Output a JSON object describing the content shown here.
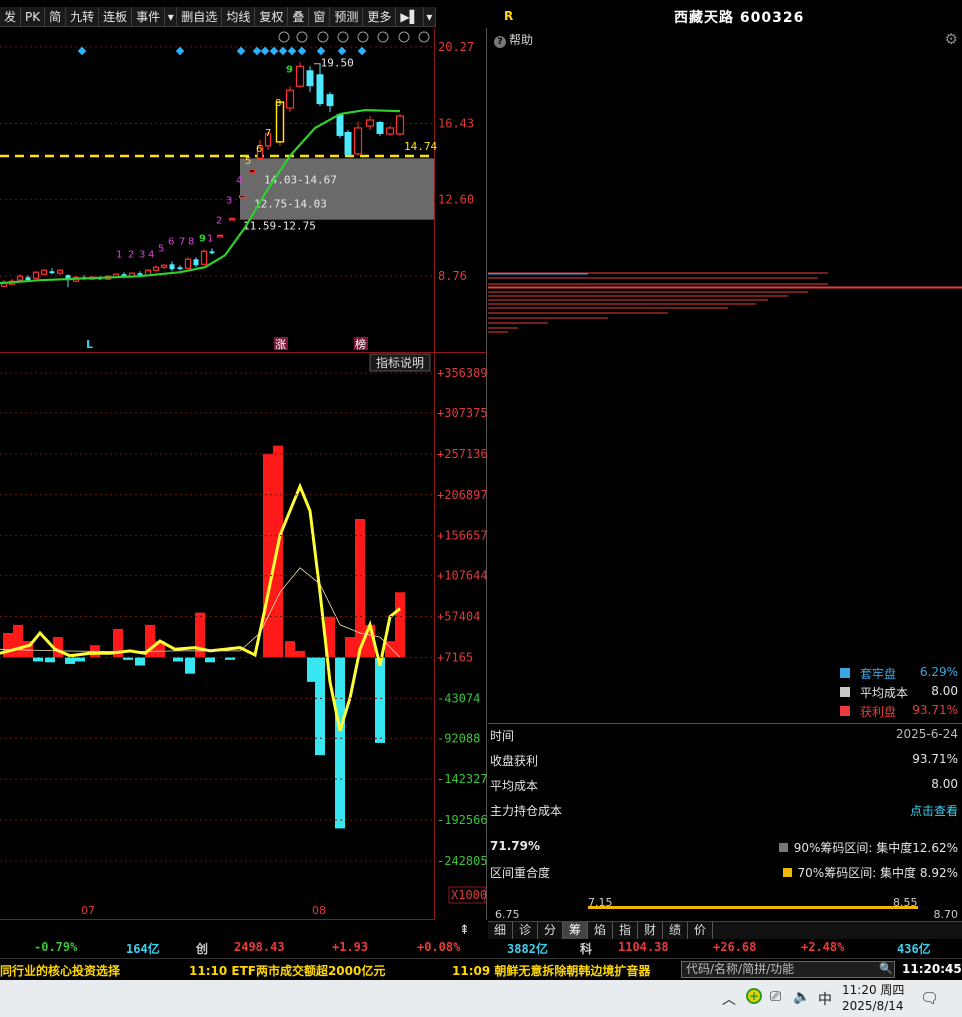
{
  "toolbar": {
    "items": [
      "发",
      "PK",
      "简",
      "九转",
      "连板",
      "事件",
      "▾",
      "删自选",
      "均线",
      "复权",
      "叠",
      "窗",
      "预测",
      "更多",
      "▶▌",
      "▾"
    ]
  },
  "stock": {
    "flag": "R",
    "title": "西藏天路 600326"
  },
  "kline": {
    "price_ticks": [
      "20.27",
      "16.43",
      "12.60",
      "8.76"
    ],
    "current_price": "14.74",
    "high_label": "19.50",
    "gap_zones": [
      "14.03-14.67",
      "12.75-14.03",
      "11.59-12.75"
    ],
    "td_seq_a": [
      "1",
      "2",
      "3",
      "4",
      "5",
      "6",
      "7",
      "8",
      "9"
    ],
    "td_seq_b": [
      "1",
      "2",
      "3",
      "4",
      "5",
      "6",
      "7",
      "8",
      "9"
    ],
    "markers": {
      "low": "L",
      "limit_up": "涨",
      "board": "榜"
    }
  },
  "indicator": {
    "explain_label": "指标说明",
    "ticks": [
      "+356389",
      "+307375",
      "+257136",
      "+206897",
      "+156657",
      "+107644",
      "+57404",
      "+7165",
      "-43074",
      "-92088",
      "-142327",
      "-192566",
      "-242805"
    ],
    "unit": "X1000",
    "months": [
      "07",
      "08"
    ]
  },
  "chip": {
    "help_label": "帮助",
    "legend": [
      {
        "name": "套牢盘",
        "value": "6.29%",
        "color": "#3ba7e0"
      },
      {
        "name": "平均成本",
        "value": "8.00",
        "color": "#c8c8c8"
      },
      {
        "name": "获利盘",
        "value": "93.71%",
        "color": "#e83b3b"
      }
    ],
    "rows": [
      {
        "k": "时间",
        "v": "2025-6-24"
      },
      {
        "k": "收盘获利",
        "v": "93.71%"
      },
      {
        "k": "平均成本",
        "v": "8.00"
      },
      {
        "k": "主力持仓成本",
        "v": "点击查看"
      }
    ],
    "overlap_pct": "71.79%",
    "overlap_label": "区间重合度",
    "band90": "90%筹码区间: 集中度12.62%",
    "band70": "70%筹码区间: 集中度 8.92%",
    "range_low": "6.75",
    "range_high": "8.70",
    "band_low": "7.15",
    "band_high": "8.55"
  },
  "bottom_tabs": [
    "细",
    "诊",
    "分",
    "筹",
    "焰",
    "指",
    "财",
    "绩",
    "价"
  ],
  "index_bar": {
    "sh_pct": "-0.79%",
    "sh_amt": "164亿",
    "cy_name": "创",
    "cy_val": "2498.43",
    "cy_chg": "+1.93",
    "cy_pct": "+0.08%",
    "cy_amt": "3882亿",
    "kc_name": "科",
    "kc_val": "1104.38",
    "kc_chg": "+26.68",
    "kc_pct": "+2.48%",
    "kc_amt": "436亿"
  },
  "news": {
    "item1": "同行业的核心投资选择",
    "item2": "11:10 ETF两市成交额超2000亿元",
    "item3": "11:09 朝鲜无意拆除朝韩边境扩音器",
    "search_placeholder": "代码/名称/简拼/功能",
    "time": "11:20:45"
  },
  "taskbar": {
    "clock_time": "11:20 周四",
    "clock_date": "2025/8/14",
    "ime": "中"
  }
}
